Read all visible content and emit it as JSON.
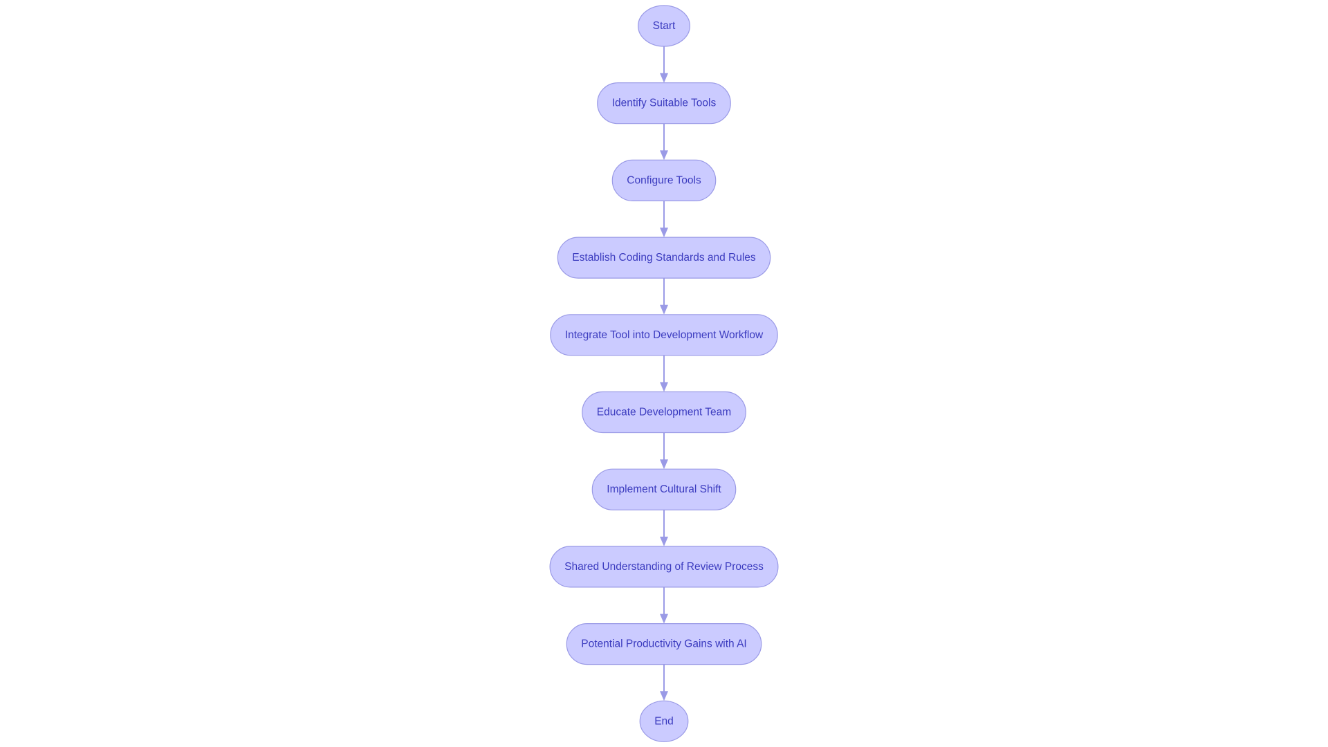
{
  "diagram": {
    "type": "flowchart",
    "direction": "top-to-bottom",
    "colors": {
      "node_fill": "#cbcbff",
      "node_border": "#9a9ae6",
      "edge": "#9a9ae6",
      "text": "#3b3bbf",
      "background": "#ffffff"
    },
    "nodes": [
      {
        "id": "start",
        "label": "Start",
        "shape": "circle"
      },
      {
        "id": "identify",
        "label": "Identify Suitable Tools",
        "shape": "stadium"
      },
      {
        "id": "configure",
        "label": "Configure Tools",
        "shape": "stadium"
      },
      {
        "id": "establish",
        "label": "Establish Coding Standards and Rules",
        "shape": "stadium"
      },
      {
        "id": "integrate",
        "label": "Integrate Tool into Development Workflow",
        "shape": "stadium"
      },
      {
        "id": "educate",
        "label": "Educate Development Team",
        "shape": "stadium"
      },
      {
        "id": "implement",
        "label": "Implement Cultural Shift",
        "shape": "stadium"
      },
      {
        "id": "shared",
        "label": "Shared Understanding of Review Process",
        "shape": "stadium"
      },
      {
        "id": "potential",
        "label": "Potential Productivity Gains with AI",
        "shape": "stadium"
      },
      {
        "id": "end",
        "label": "End",
        "shape": "circle"
      }
    ],
    "edges": [
      {
        "from": "start",
        "to": "identify"
      },
      {
        "from": "identify",
        "to": "configure"
      },
      {
        "from": "configure",
        "to": "establish"
      },
      {
        "from": "establish",
        "to": "integrate"
      },
      {
        "from": "integrate",
        "to": "educate"
      },
      {
        "from": "educate",
        "to": "implement"
      },
      {
        "from": "implement",
        "to": "shared"
      },
      {
        "from": "shared",
        "to": "potential"
      },
      {
        "from": "potential",
        "to": "end"
      }
    ]
  }
}
